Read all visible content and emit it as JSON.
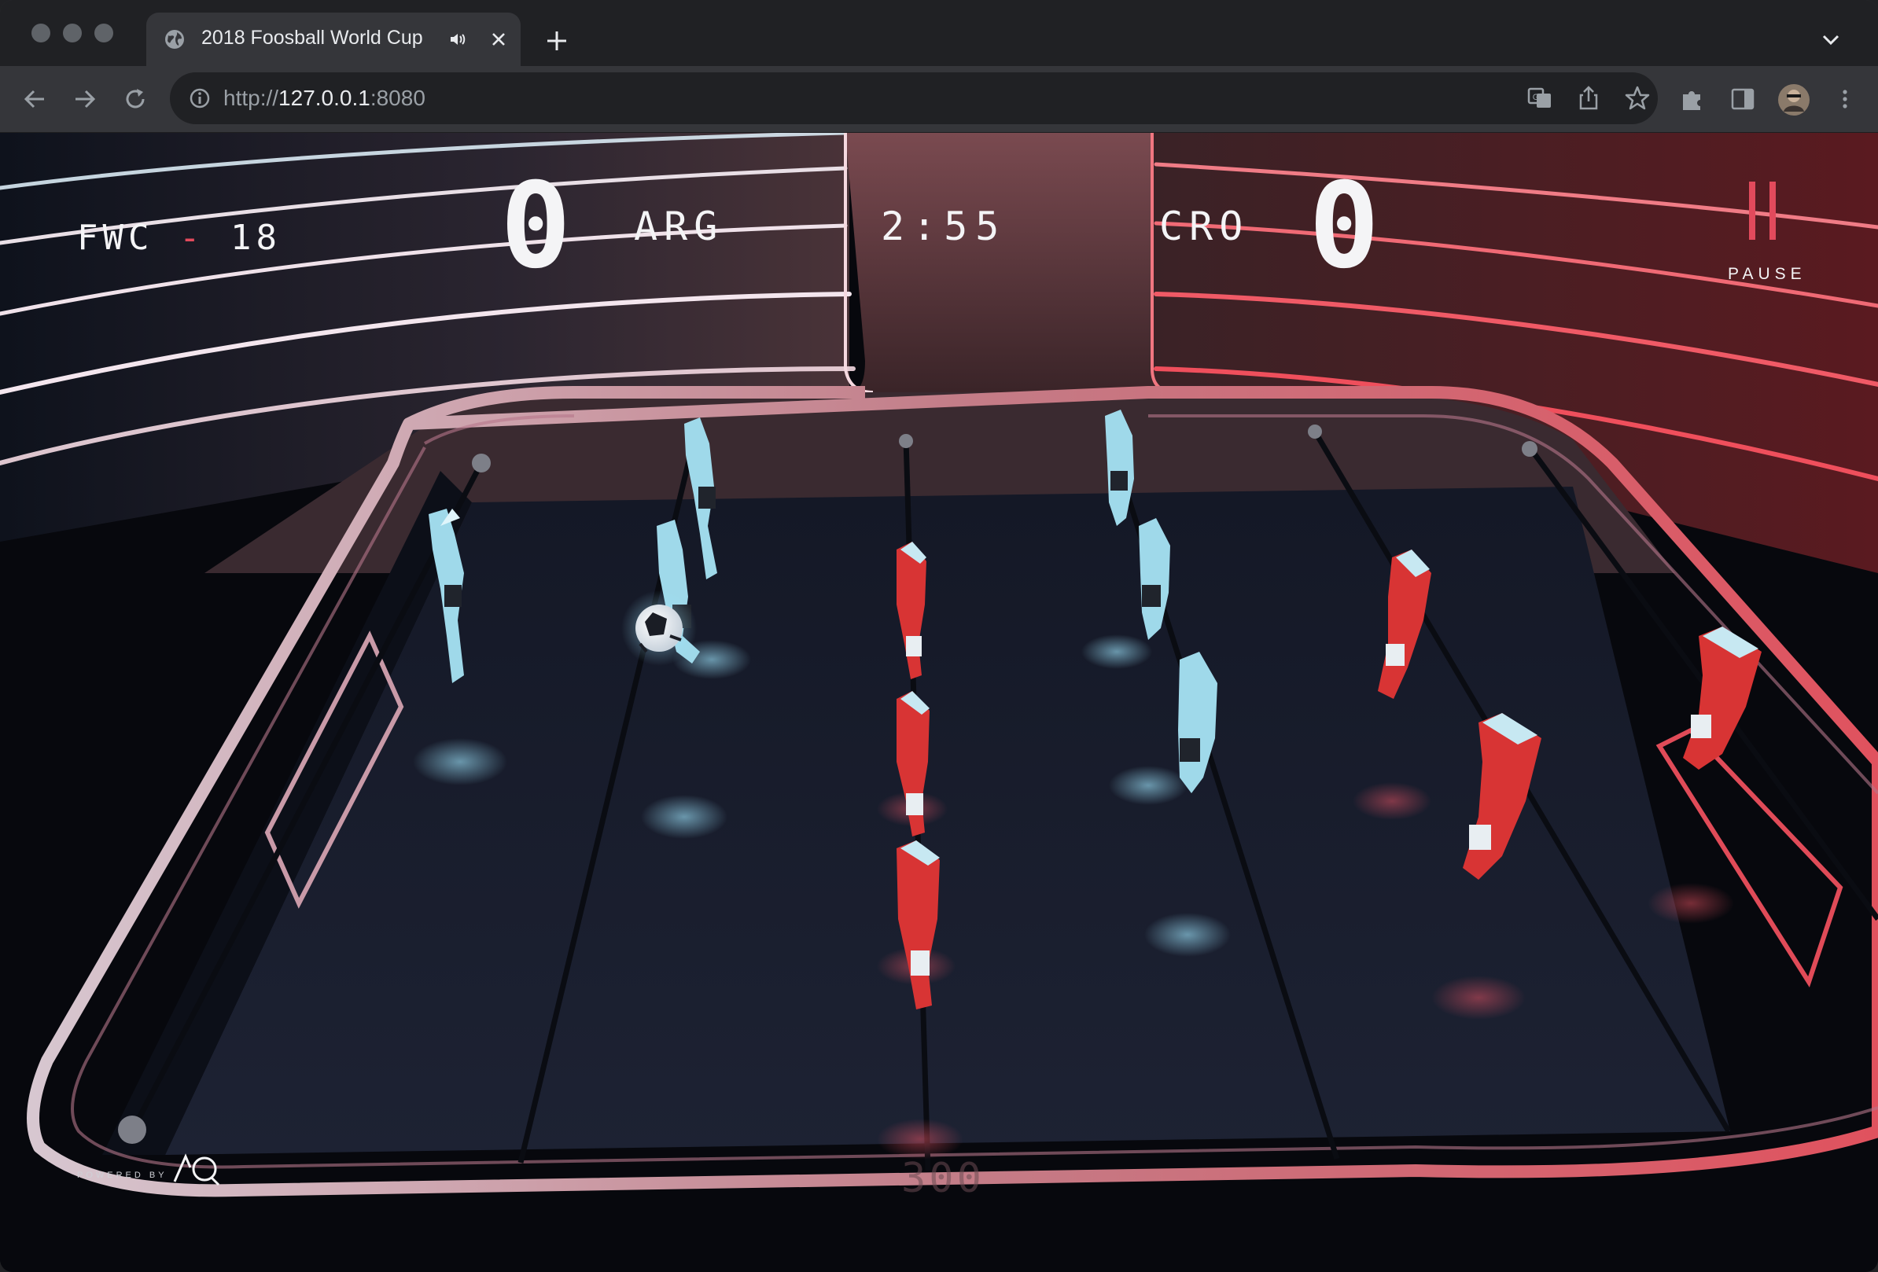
{
  "browser": {
    "tab_title": "2018 Foosball World Cup",
    "url_scheme": "http://",
    "url_host": "127.0.0.1",
    "url_port": ":8080",
    "favicon": "globe-icon"
  },
  "scoreboard": {
    "brand_left": "FWC",
    "brand_dash": "-",
    "brand_right": "18",
    "home_score": "0",
    "home_team": "ARG",
    "timer": "2:55",
    "away_team": "CRO",
    "away_score": "0",
    "pause_label": "PAUSE"
  },
  "footer": {
    "powered_by": "POWERED BY",
    "logo": "AQ",
    "faded_number": "300"
  },
  "colors": {
    "home_team": "#9fd9ea",
    "away_team": "#d83434",
    "accent_pink": "#e24a5c",
    "table_floor": "#1a1f2e"
  }
}
